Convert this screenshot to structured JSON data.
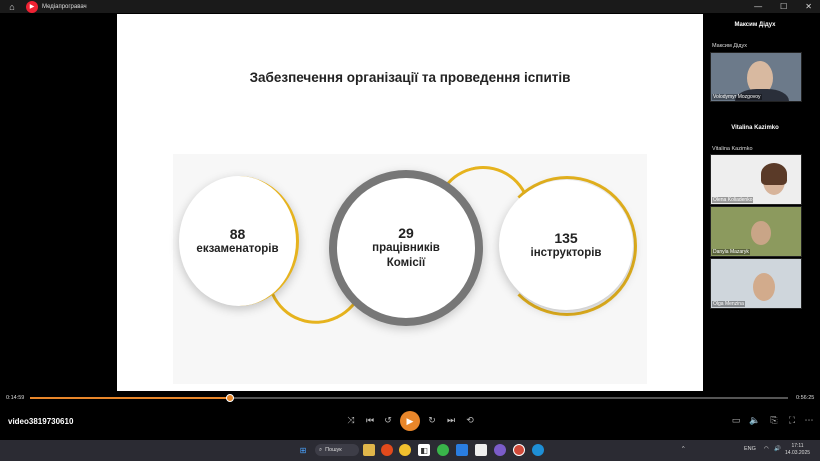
{
  "window": {
    "app_title": "Медіапрогравач",
    "controls": {
      "minimize": "—",
      "maximize": "☐",
      "close": "✕"
    }
  },
  "slide": {
    "title": "Забезпечення організації та проведення іспитів",
    "stats": [
      {
        "number": "88",
        "label": "екзаменаторів"
      },
      {
        "number": "29",
        "label_line1": "працівників",
        "label_line2": "Комісії"
      },
      {
        "number": "135",
        "label": "інструкторів"
      }
    ]
  },
  "participants": {
    "host_heading": "Максим Дідух",
    "host_label": "Максим Дідух",
    "tile1_tag": "Volodymyr Mozgovoy",
    "second_heading": "Vitalina Kazimko",
    "second_label": "Vitalina Kazimko",
    "tile2_tag": "Olena Koliadenko",
    "tile3_tag": "Danyla Mazaryk",
    "tile4_tag": "Olga Menzina"
  },
  "player": {
    "current_time": "0:14:59",
    "total_time": "0:56:25",
    "progress_fraction": 0.2645,
    "video_name": "video3819730610"
  },
  "taskbar": {
    "search_placeholder": "Пошук",
    "language": "ENG",
    "time": "17:11",
    "date": "14.03.2025"
  },
  "colors": {
    "accent": "#e8862a",
    "ring_gold": "#e6b31e",
    "ring_gray": "#777777"
  }
}
